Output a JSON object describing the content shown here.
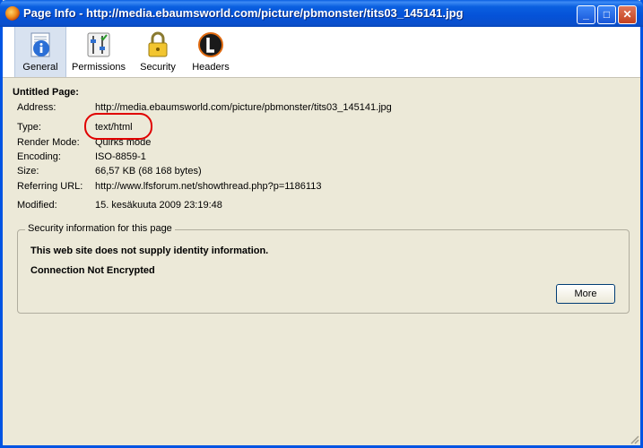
{
  "window": {
    "title": "Page Info - http://media.ebaumsworld.com/picture/pbmonster/tits03_145141.jpg",
    "controls": {
      "minimize": "_",
      "maximize": "□",
      "close": "✕"
    }
  },
  "tabs": [
    {
      "label": "General",
      "icon": "info-document-icon",
      "selected": true
    },
    {
      "label": "Permissions",
      "icon": "sliders-checkmark-icon",
      "selected": false
    },
    {
      "label": "Security",
      "icon": "padlock-icon",
      "selected": false
    },
    {
      "label": "Headers",
      "icon": "live-headers-icon",
      "selected": false
    }
  ],
  "general": {
    "heading": "Untitled Page:",
    "fields": [
      {
        "label": "Address:",
        "value": "http://media.ebaumsworld.com/picture/pbmonster/tits03_145141.jpg"
      },
      {
        "label": "Type:",
        "value": "text/html"
      },
      {
        "label": "Render Mode:",
        "value": "Quirks mode"
      },
      {
        "label": "Encoding:",
        "value": "ISO-8859-1"
      },
      {
        "label": "Size:",
        "value": "66,57 KB (68 168 bytes)"
      },
      {
        "label": "Referring URL:",
        "value": "http://www.lfsforum.net/showthread.php?p=1186113"
      },
      {
        "label": "Modified:",
        "value": "15. kesäkuuta 2009 23:19:48"
      }
    ]
  },
  "security": {
    "group_title": "Security information for this page",
    "identity": "This web site does not supply identity information.",
    "encryption": "Connection Not Encrypted",
    "more_button": "More"
  },
  "colors": {
    "titlebar": "#0a5fe0",
    "annotation_circle": "#e00000",
    "dialog_bg": "#ece9d8"
  }
}
